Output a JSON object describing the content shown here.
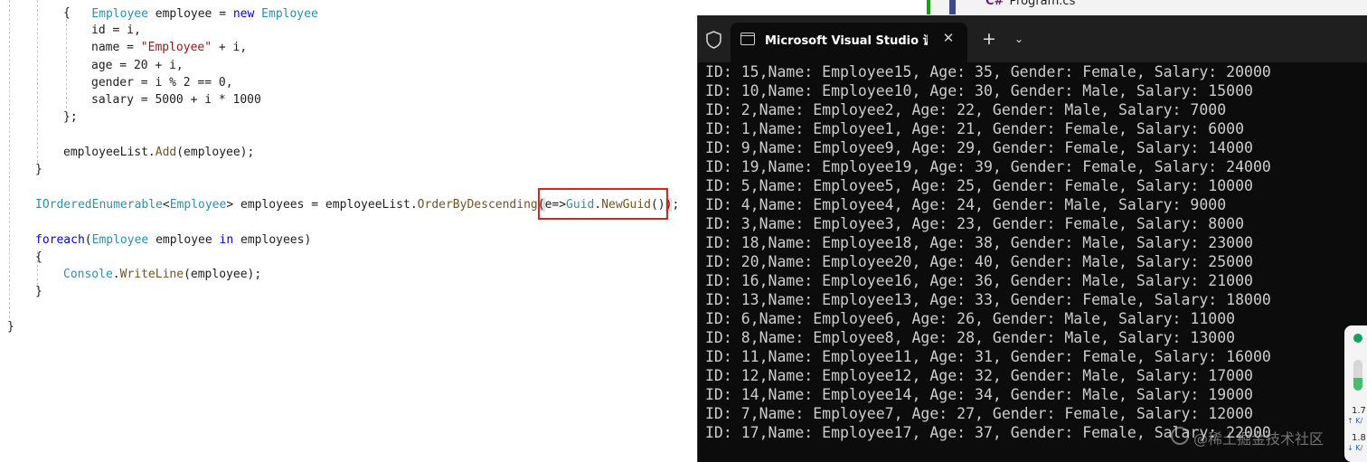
{
  "editor": {
    "lines": [
      {
        "name": "code-line-id",
        "tokens": [
          {
            "text": "id = ",
            "cls": "t-plain"
          },
          {
            "text": "i",
            "cls": "t-plain"
          },
          {
            "text": ",",
            "cls": "t-plain"
          }
        ]
      },
      {
        "name": "code-line-name",
        "tokens": [
          {
            "text": "name = ",
            "cls": "t-plain"
          },
          {
            "text": "\"Employee\"",
            "cls": "t-str"
          },
          {
            "text": " + i,",
            "cls": "t-plain"
          }
        ]
      },
      {
        "name": "code-line-age",
        "tokens": [
          {
            "text": "age = 20 + i,",
            "cls": "t-plain"
          }
        ]
      },
      {
        "name": "code-line-gender",
        "tokens": [
          {
            "text": "gender = i % 2 == 0,",
            "cls": "t-plain"
          }
        ]
      },
      {
        "name": "code-line-salary",
        "tokens": [
          {
            "text": "salary = 5000 + i * 1000",
            "cls": "t-plain"
          }
        ]
      },
      {
        "name": "code-line-close-init",
        "tokens": [
          {
            "text": "};",
            "cls": "t-plain"
          }
        ]
      },
      {
        "name": "code-line-add",
        "tokens": [
          {
            "text": "employeeList.",
            "cls": "t-plain"
          },
          {
            "text": "Add",
            "cls": "t-method"
          },
          {
            "text": "(employee);",
            "cls": "t-plain"
          }
        ]
      },
      {
        "name": "code-line-close-for",
        "tokens": [
          {
            "text": "}",
            "cls": "t-plain"
          }
        ]
      },
      {
        "name": "code-line-orderby",
        "tokens": [
          {
            "text": "IOrderedEnumerable",
            "cls": "t-type"
          },
          {
            "text": "<",
            "cls": "t-plain"
          },
          {
            "text": "Employee",
            "cls": "t-type"
          },
          {
            "text": "> employees = employeeList.",
            "cls": "t-plain"
          },
          {
            "text": "OrderByDescending",
            "cls": "t-method"
          },
          {
            "text": "(",
            "cls": "hl-paren"
          },
          {
            "text": "e=>",
            "cls": "t-plain"
          },
          {
            "text": "Guid",
            "cls": "t-type"
          },
          {
            "text": ".",
            "cls": "t-plain"
          },
          {
            "text": "NewGuid",
            "cls": "t-method"
          },
          {
            "text": "()",
            "cls": "t-plain"
          },
          {
            "text": ")",
            "cls": "hl-paren"
          },
          {
            "text": ";",
            "cls": "t-plain"
          }
        ]
      },
      {
        "name": "code-line-foreach",
        "tokens": [
          {
            "text": "foreach",
            "cls": "t-kw"
          },
          {
            "text": "(",
            "cls": "t-plain"
          },
          {
            "text": "Employee",
            "cls": "t-type"
          },
          {
            "text": " employee ",
            "cls": "t-plain"
          },
          {
            "text": "in",
            "cls": "t-kw"
          },
          {
            "text": " employees)",
            "cls": "t-plain"
          }
        ]
      },
      {
        "name": "code-line-open-foreach",
        "tokens": [
          {
            "text": "{",
            "cls": "t-plain"
          }
        ]
      },
      {
        "name": "code-line-writeline",
        "tokens": [
          {
            "text": "Console",
            "cls": "t-type"
          },
          {
            "text": ".",
            "cls": "t-plain"
          },
          {
            "text": "WriteLine",
            "cls": "t-method"
          },
          {
            "text": "(employee);",
            "cls": "t-plain"
          }
        ]
      },
      {
        "name": "code-line-close-foreach",
        "tokens": [
          {
            "text": "}",
            "cls": "t-plain"
          }
        ]
      },
      {
        "name": "code-line-close-method",
        "tokens": [
          {
            "text": "}",
            "cls": "t-plain"
          }
        ]
      }
    ],
    "open_brace": "{"
  },
  "background": {
    "file_icon": "C#",
    "file_name": "Program.cs"
  },
  "terminal": {
    "tab_title": "Microsoft Visual Studio 调试控制台",
    "close_symbol": "✕",
    "new_tab_symbol": "+",
    "dropdown_symbol": "⌄",
    "output": [
      "ID: 15,Name: Employee15, Age: 35, Gender: Female, Salary: 20000",
      "ID: 10,Name: Employee10, Age: 30, Gender: Male, Salary: 15000",
      "ID: 2,Name: Employee2, Age: 22, Gender: Male, Salary: 7000",
      "ID: 1,Name: Employee1, Age: 21, Gender: Female, Salary: 6000",
      "ID: 9,Name: Employee9, Age: 29, Gender: Female, Salary: 14000",
      "ID: 19,Name: Employee19, Age: 39, Gender: Female, Salary: 24000",
      "ID: 5,Name: Employee5, Age: 25, Gender: Female, Salary: 10000",
      "ID: 4,Name: Employee4, Age: 24, Gender: Male, Salary: 9000",
      "ID: 3,Name: Employee3, Age: 23, Gender: Female, Salary: 8000",
      "ID: 18,Name: Employee18, Age: 38, Gender: Male, Salary: 23000",
      "ID: 20,Name: Employee20, Age: 40, Gender: Male, Salary: 25000",
      "ID: 16,Name: Employee16, Age: 36, Gender: Male, Salary: 21000",
      "ID: 13,Name: Employee13, Age: 33, Gender: Female, Salary: 18000",
      "ID: 6,Name: Employee6, Age: 26, Gender: Male, Salary: 11000",
      "ID: 8,Name: Employee8, Age: 28, Gender: Male, Salary: 13000",
      "ID: 11,Name: Employee11, Age: 31, Gender: Female, Salary: 16000",
      "ID: 12,Name: Employee12, Age: 32, Gender: Male, Salary: 17000",
      "ID: 14,Name: Employee14, Age: 34, Gender: Male, Salary: 19000",
      "ID: 7,Name: Employee7, Age: 27, Gender: Female, Salary: 12000",
      "ID: 17,Name: Employee17, Age: 37, Gender: Female, Salary: 22000"
    ]
  },
  "watermark": "@稀土掘金技术社区",
  "widget": {
    "upload_value": "1.7",
    "upload_unit": "↑ K/",
    "download_value": "1.8",
    "download_unit": "↓ K/",
    "bar_level": 0.4,
    "status_color": "#13a15e"
  }
}
